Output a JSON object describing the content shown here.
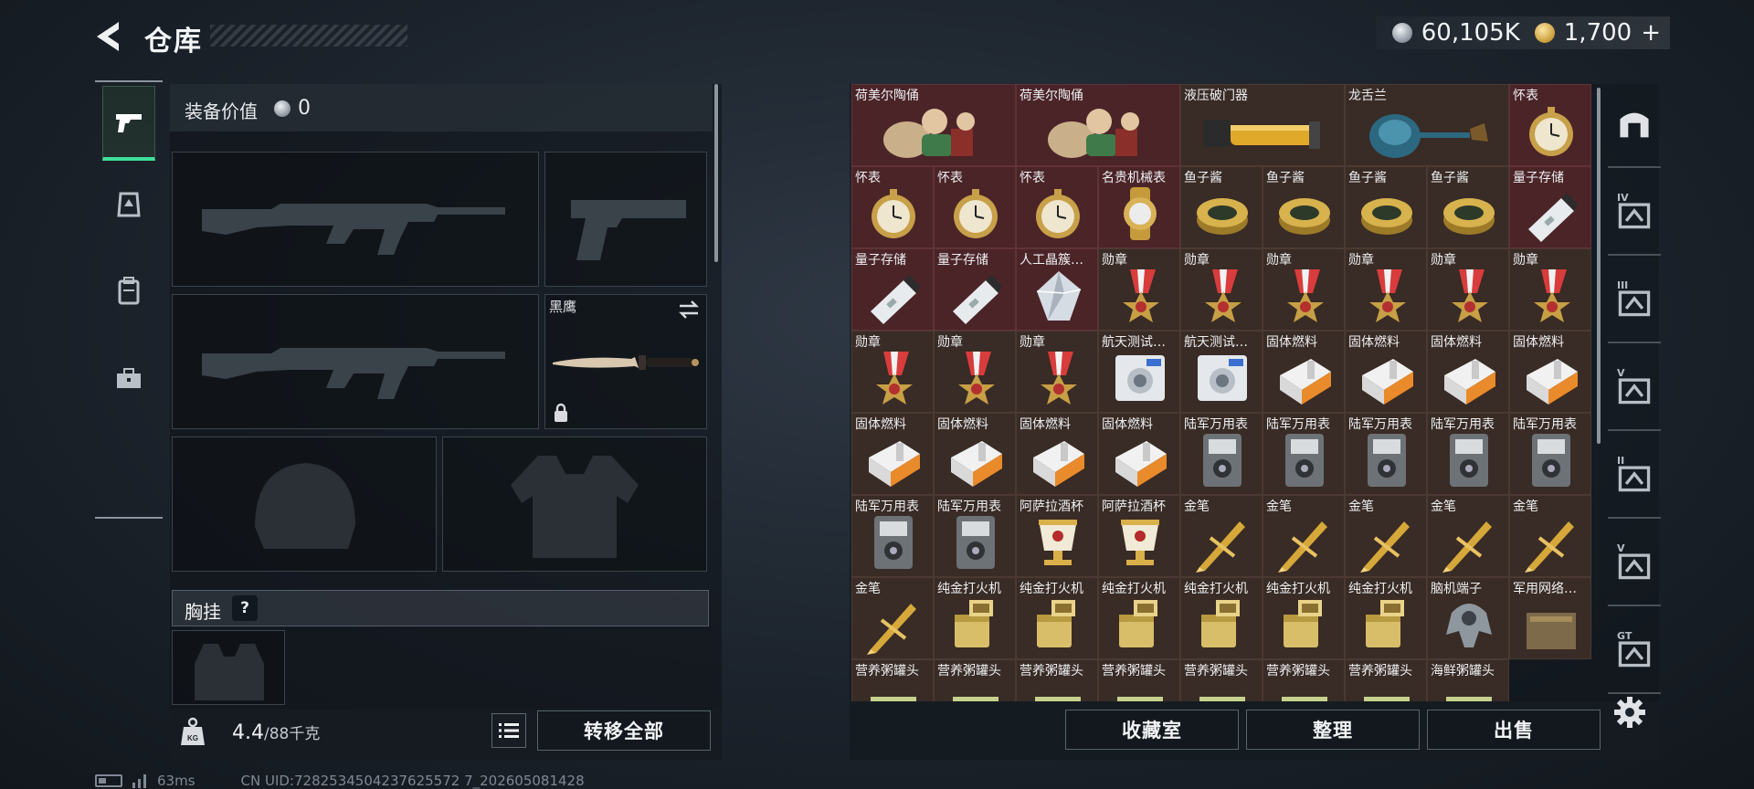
{
  "header": {
    "title": "仓库"
  },
  "currency": {
    "silver": "60,105K",
    "gold": "1,700",
    "gold_plus": "+"
  },
  "left_tabs": [
    {
      "name": "weapons-tab",
      "icon": "pistol-icon",
      "active": true
    },
    {
      "name": "armor-tab",
      "icon": "armor-upgrade-icon",
      "active": false
    },
    {
      "name": "backpack-tab",
      "icon": "backpack-icon",
      "active": false
    },
    {
      "name": "toolbox-tab",
      "icon": "toolbox-icon",
      "active": false
    }
  ],
  "equipment": {
    "value_label": "装备价值",
    "value": "0",
    "melee_label": "黑鹰",
    "chest_label": "胸挂",
    "help": "?",
    "weight_current": "4.4",
    "weight_max": "/88千克",
    "transfer_all": "转移全部"
  },
  "inventory": {
    "items": [
      {
        "name": "荷美尔陶俑",
        "icon": "figurine",
        "bg": "red",
        "wide": true
      },
      {
        "name": "荷美尔陶俑",
        "icon": "figurine",
        "bg": "red",
        "wide": true
      },
      {
        "name": "液压破门器",
        "icon": "hydraulic-breacher",
        "bg": "brown",
        "wide": true
      },
      {
        "name": "龙舌兰",
        "icon": "tequila-bottle",
        "bg": "brown",
        "wide": true
      },
      {
        "name": "怀表",
        "icon": "pocket-watch",
        "bg": "red"
      },
      {
        "name": "怀表",
        "icon": "pocket-watch",
        "bg": "red"
      },
      {
        "name": "怀表",
        "icon": "pocket-watch",
        "bg": "red"
      },
      {
        "name": "怀表",
        "icon": "pocket-watch",
        "bg": "red"
      },
      {
        "name": "名贵机械表",
        "icon": "wristwatch",
        "bg": "red"
      },
      {
        "name": "鱼子酱",
        "icon": "caviar-tin",
        "bg": "brown"
      },
      {
        "name": "鱼子酱",
        "icon": "caviar-tin",
        "bg": "brown"
      },
      {
        "name": "鱼子酱",
        "icon": "caviar-tin",
        "bg": "brown"
      },
      {
        "name": "鱼子酱",
        "icon": "caviar-tin",
        "bg": "brown"
      },
      {
        "name": "量子存储",
        "icon": "quantum-storage",
        "bg": "red"
      },
      {
        "name": "量子存储",
        "icon": "quantum-storage",
        "bg": "red"
      },
      {
        "name": "量子存储",
        "icon": "quantum-storage",
        "bg": "red"
      },
      {
        "name": "人工晶簇…",
        "icon": "crystal",
        "bg": "red"
      },
      {
        "name": "勋章",
        "icon": "medal",
        "bg": "brown"
      },
      {
        "name": "勋章",
        "icon": "medal",
        "bg": "brown"
      },
      {
        "name": "勋章",
        "icon": "medal",
        "bg": "brown"
      },
      {
        "name": "勋章",
        "icon": "medal",
        "bg": "brown"
      },
      {
        "name": "勋章",
        "icon": "medal",
        "bg": "brown"
      },
      {
        "name": "勋章",
        "icon": "medal",
        "bg": "brown"
      },
      {
        "name": "勋章",
        "icon": "medal",
        "bg": "brown"
      },
      {
        "name": "勋章",
        "icon": "medal",
        "bg": "brown"
      },
      {
        "name": "勋章",
        "icon": "medal",
        "bg": "brown"
      },
      {
        "name": "航天测试…",
        "icon": "aerospace-tester",
        "bg": "brown"
      },
      {
        "name": "航天测试…",
        "icon": "aerospace-tester",
        "bg": "brown"
      },
      {
        "name": "固体燃料",
        "icon": "solid-fuel",
        "bg": "brown"
      },
      {
        "name": "固体燃料",
        "icon": "solid-fuel",
        "bg": "brown"
      },
      {
        "name": "固体燃料",
        "icon": "solid-fuel",
        "bg": "brown"
      },
      {
        "name": "固体燃料",
        "icon": "solid-fuel",
        "bg": "brown"
      },
      {
        "name": "固体燃料",
        "icon": "solid-fuel",
        "bg": "brown"
      },
      {
        "name": "固体燃料",
        "icon": "solid-fuel",
        "bg": "brown"
      },
      {
        "name": "固体燃料",
        "icon": "solid-fuel",
        "bg": "brown"
      },
      {
        "name": "固体燃料",
        "icon": "solid-fuel",
        "bg": "brown"
      },
      {
        "name": "陆军万用表",
        "icon": "multimeter",
        "bg": "brown"
      },
      {
        "name": "陆军万用表",
        "icon": "multimeter",
        "bg": "brown"
      },
      {
        "name": "陆军万用表",
        "icon": "multimeter",
        "bg": "brown"
      },
      {
        "name": "陆军万用表",
        "icon": "multimeter",
        "bg": "brown"
      },
      {
        "name": "陆军万用表",
        "icon": "multimeter",
        "bg": "brown"
      },
      {
        "name": "陆军万用表",
        "icon": "multimeter",
        "bg": "brown"
      },
      {
        "name": "陆军万用表",
        "icon": "multimeter",
        "bg": "brown"
      },
      {
        "name": "阿萨拉酒杯",
        "icon": "gold-cup",
        "bg": "brown"
      },
      {
        "name": "阿萨拉酒杯",
        "icon": "gold-cup",
        "bg": "brown"
      },
      {
        "name": "金笔",
        "icon": "gold-pen",
        "bg": "brown"
      },
      {
        "name": "金笔",
        "icon": "gold-pen",
        "bg": "brown"
      },
      {
        "name": "金笔",
        "icon": "gold-pen",
        "bg": "brown"
      },
      {
        "name": "金笔",
        "icon": "gold-pen",
        "bg": "brown"
      },
      {
        "name": "金笔",
        "icon": "gold-pen",
        "bg": "brown"
      },
      {
        "name": "金笔",
        "icon": "gold-pen",
        "bg": "brown"
      },
      {
        "name": "纯金打火机",
        "icon": "gold-lighter",
        "bg": "brown"
      },
      {
        "name": "纯金打火机",
        "icon": "gold-lighter",
        "bg": "brown"
      },
      {
        "name": "纯金打火机",
        "icon": "gold-lighter",
        "bg": "brown"
      },
      {
        "name": "纯金打火机",
        "icon": "gold-lighter",
        "bg": "brown"
      },
      {
        "name": "纯金打火机",
        "icon": "gold-lighter",
        "bg": "brown"
      },
      {
        "name": "纯金打火机",
        "icon": "gold-lighter",
        "bg": "brown"
      },
      {
        "name": "脑机端子",
        "icon": "brain-terminal",
        "bg": "brown"
      },
      {
        "name": "军用网络…",
        "icon": "network-module",
        "bg": "brown"
      },
      {
        "name": "营养粥罐头",
        "icon": "porridge-can",
        "bg": "brown"
      },
      {
        "name": "营养粥罐头",
        "icon": "porridge-can",
        "bg": "brown"
      },
      {
        "name": "营养粥罐头",
        "icon": "porridge-can",
        "bg": "brown"
      },
      {
        "name": "营养粥罐头",
        "icon": "porridge-can",
        "bg": "brown"
      },
      {
        "name": "营养粥罐头",
        "icon": "porridge-can",
        "bg": "brown"
      },
      {
        "name": "营养粥罐头",
        "icon": "porridge-can",
        "bg": "brown"
      },
      {
        "name": "营养粥罐头",
        "icon": "porridge-can",
        "bg": "brown"
      },
      {
        "name": "海鲜粥罐头",
        "icon": "porridge-can",
        "bg": "brown"
      }
    ]
  },
  "right_tabs": [
    {
      "name": "main-storage-tab",
      "icon": "storage-arch-icon",
      "label": "",
      "active": true
    },
    {
      "name": "storage-tab-iv",
      "icon": "storage-crate-icon",
      "label": "IV"
    },
    {
      "name": "storage-tab-iii",
      "icon": "storage-crate-icon",
      "label": "III"
    },
    {
      "name": "storage-tab-v",
      "icon": "storage-crate-icon",
      "label": "V"
    },
    {
      "name": "storage-tab-ii",
      "icon": "storage-crate-icon",
      "label": "II"
    },
    {
      "name": "storage-tab-v2",
      "icon": "storage-crate-icon",
      "label": "V"
    },
    {
      "name": "storage-tab-gt",
      "icon": "storage-crate-icon",
      "label": "GT"
    }
  ],
  "actions": {
    "collection": "收藏室",
    "sort": "整理",
    "sell": "出售"
  },
  "status": {
    "ping": "63ms",
    "uid": "CN UID:7282534504237625572 7_202605081428"
  },
  "colors": {
    "accent_green": "#3fe09a",
    "cell_red": "#4b2428",
    "cell_brown": "#392b25"
  }
}
